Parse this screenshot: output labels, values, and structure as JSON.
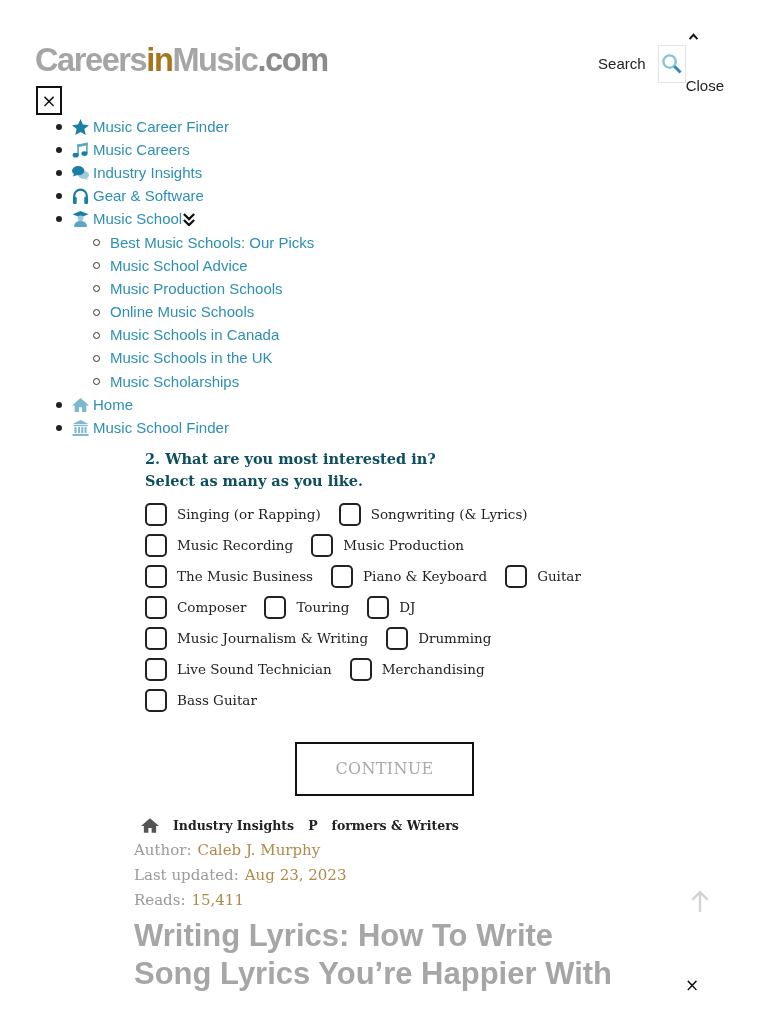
{
  "header": {
    "logo": [
      {
        "text": "Careers",
        "kind": "plain"
      },
      {
        "text": "in",
        "kind": "accent"
      },
      {
        "text": "Music",
        "kind": "plain"
      },
      {
        "text": ".com",
        "kind": "domain"
      }
    ],
    "search_label": "Search",
    "close_label": "Close"
  },
  "menu_close": "×",
  "nav": {
    "items": [
      {
        "label": "Music Career Finder",
        "expanded": false
      },
      {
        "label": "Music Careers",
        "expanded": false
      },
      {
        "label": "Industry Insights",
        "expanded": false
      },
      {
        "label": "Gear & Software",
        "expanded": false
      },
      {
        "label": "Music School",
        "expanded": true,
        "children": [
          {
            "label": "Best Music Schools: Our Picks"
          },
          {
            "label": "Music School Advice"
          },
          {
            "label": "Music Production Schools"
          },
          {
            "label": "Online Music Schools"
          },
          {
            "label": "Music Schools in Canada"
          },
          {
            "label": "Music Schools in the UK"
          },
          {
            "label": "Music Scholarships"
          }
        ]
      },
      {
        "label": "Home",
        "expanded": false
      },
      {
        "label": "Music School Finder",
        "expanded": false
      }
    ]
  },
  "quiz": {
    "question": "2. What are you most interested in?",
    "instruction": "Select as many as you like.",
    "option_rows": [
      [
        {
          "label": "Singing (or Rapping)",
          "checked": false
        },
        {
          "label": "Songwriting (& Lyrics)",
          "checked": false
        }
      ],
      [
        {
          "label": "Music Recording",
          "checked": false
        },
        {
          "label": "Music Production",
          "checked": false
        }
      ],
      [
        {
          "label": "The Music Business",
          "checked": false
        },
        {
          "label": "Piano & Keyboard",
          "checked": false
        },
        {
          "label": "Guitar",
          "checked": false
        }
      ],
      [
        {
          "label": "Composer",
          "checked": false
        },
        {
          "label": "Touring",
          "checked": false
        },
        {
          "label": "DJ",
          "checked": false
        }
      ],
      [
        {
          "label": "Music Journalism & Writing",
          "checked": false
        },
        {
          "label": "Drumming",
          "checked": false
        }
      ],
      [
        {
          "label": "Live Sound Technician",
          "checked": false
        },
        {
          "label": "Merchandising",
          "checked": false
        }
      ],
      [
        {
          "label": "Bass Guitar",
          "checked": false
        }
      ]
    ],
    "continue": {
      "label": "CONTINUE",
      "disabled": true
    }
  },
  "article": {
    "breadcrumb": [
      "Industry Insights",
      "P",
      "formers & Writers"
    ],
    "meta": [
      {
        "label": "Author:",
        "value": "Caleb J. Murphy"
      },
      {
        "label": "Last updated:",
        "value": "Aug 23, 2023"
      },
      {
        "label": "Reads:",
        "value": "15,411"
      }
    ],
    "title": "Writing Lyrics: How To Write Song Lyrics You’re Happier With"
  },
  "dismiss": "×"
}
